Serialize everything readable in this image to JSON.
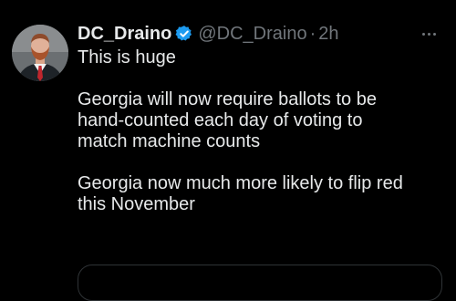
{
  "tweet": {
    "author": {
      "display_name": "DC_Draino",
      "handle": "@DC_Draino",
      "verified_icon": "verified-badge-icon",
      "avatar_icon": "avatar"
    },
    "separator": "·",
    "time": "2h",
    "more_icon": "more-options-icon",
    "text": {
      "line1": "This is huge",
      "para2": [
        "Georgia will now require ballots to be",
        "hand-counted each day of voting to",
        "match machine counts"
      ],
      "para3": [
        "Georgia now much more likely to flip red",
        "this November"
      ]
    }
  },
  "colors": {
    "background": "#000000",
    "primary_text": "#e7e9ea",
    "secondary_text": "#71767b",
    "verified_blue": "#1d9bf0",
    "border": "#2f3336"
  }
}
